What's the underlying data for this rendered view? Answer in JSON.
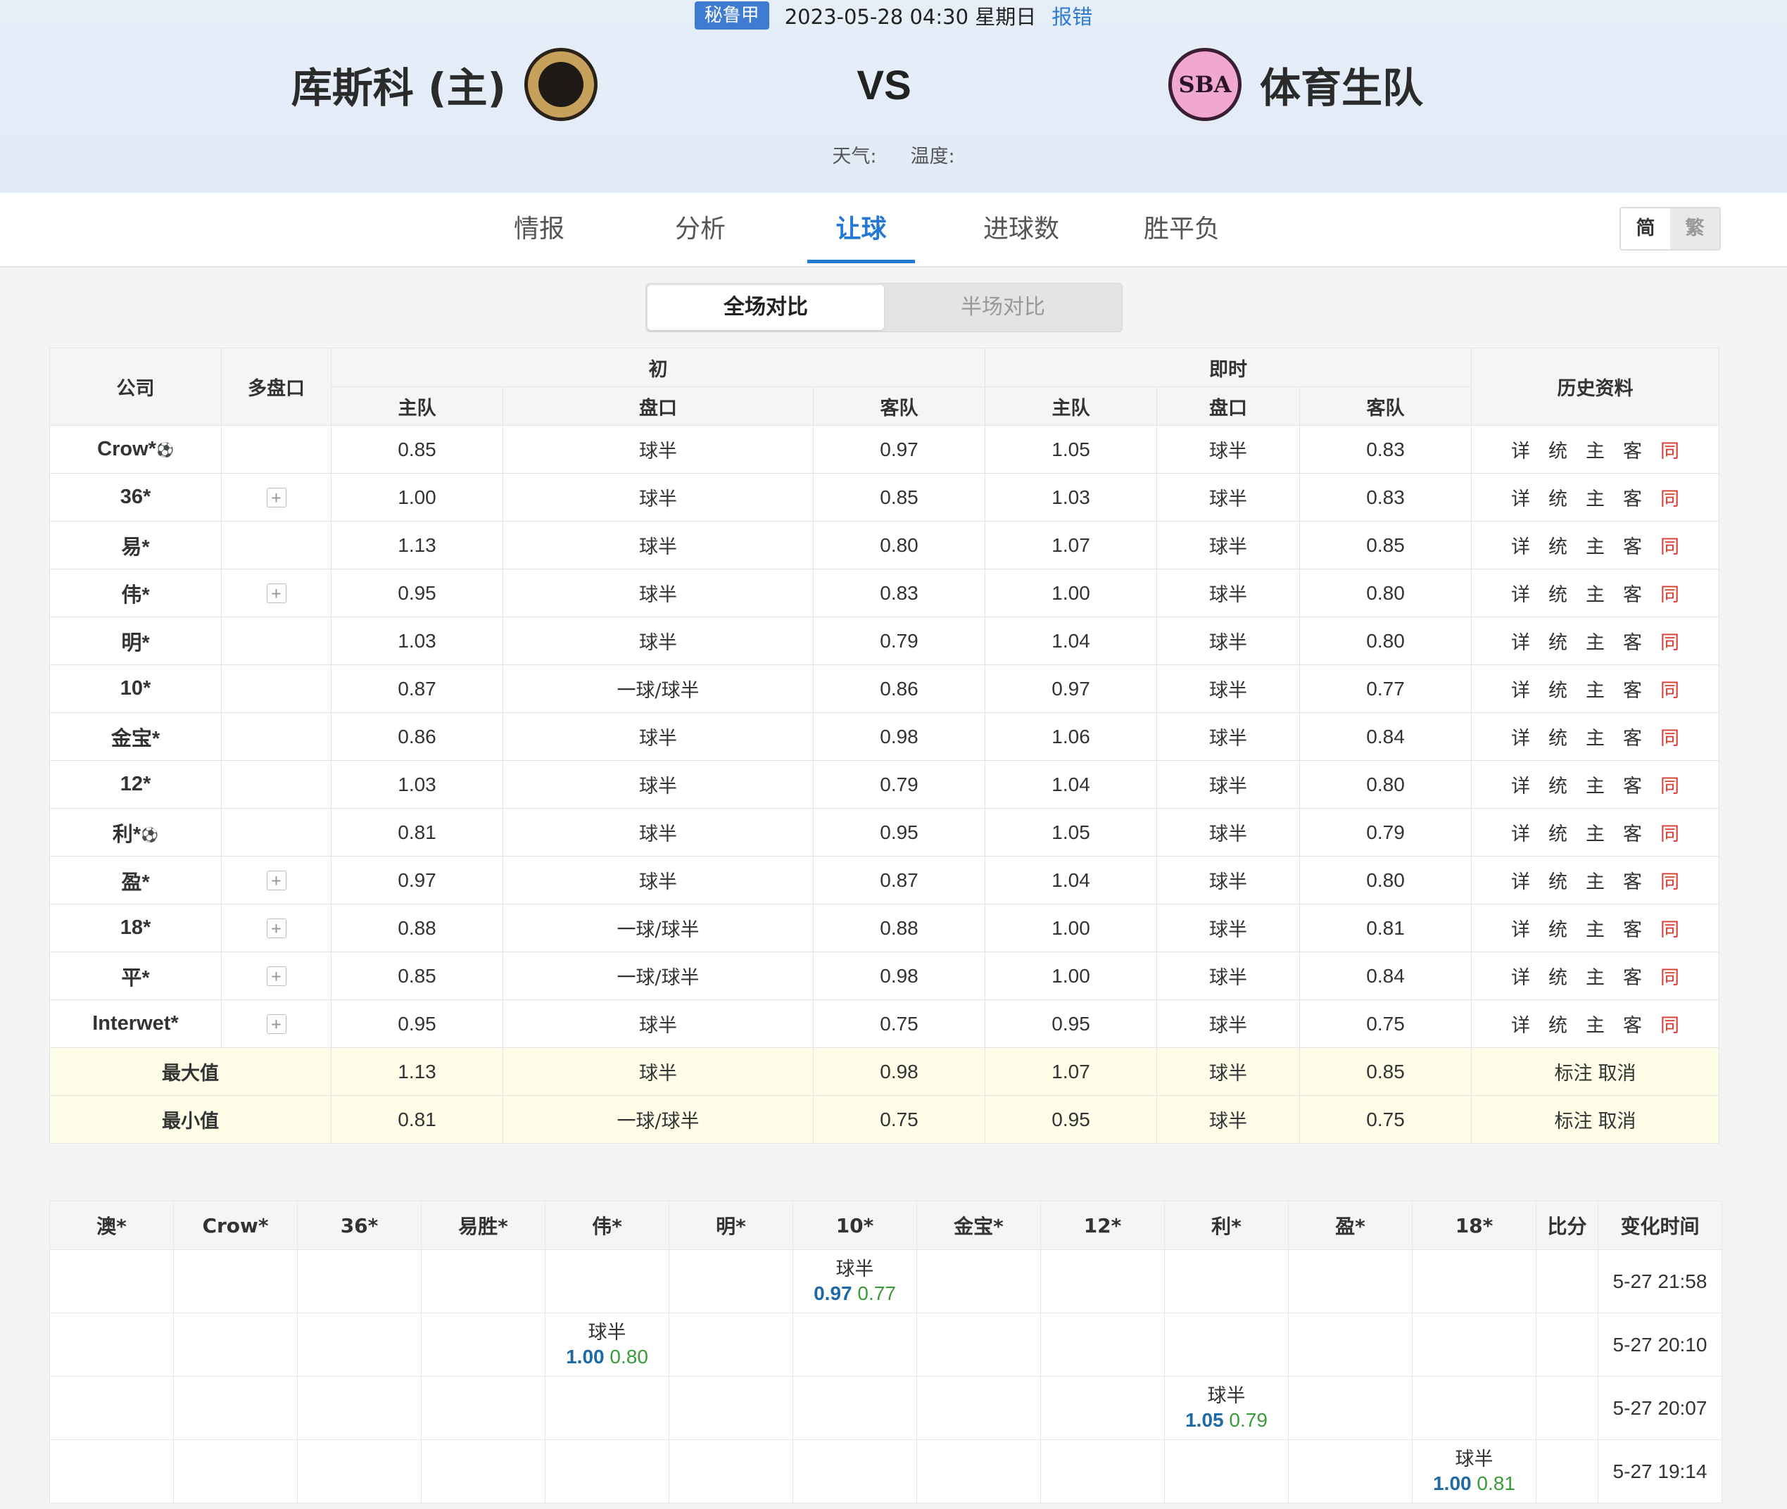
{
  "match": {
    "league": "秘鲁甲",
    "datetime": "2023-05-28 04:30 星期日",
    "report": "报错",
    "home_team": "库斯科 (主)",
    "away_team": "体育生队",
    "vs": "VS",
    "weather_label": "天气:",
    "temperature_label": "温度:",
    "away_logo_text": "SBA"
  },
  "tabs": [
    "情报",
    "分析",
    "让球",
    "进球数",
    "胜平负"
  ],
  "active_tab": "让球",
  "lang": {
    "simplified": "简",
    "traditional": "繁"
  },
  "segment": {
    "full": "全场对比",
    "half": "半场对比"
  },
  "odds_table": {
    "headers": {
      "company": "公司",
      "multi": "多盘口",
      "initial": "初",
      "live": "即时",
      "history": "历史资料",
      "home": "主队",
      "line": "盘口",
      "away": "客队"
    },
    "history_links": [
      "详",
      "统",
      "主",
      "客",
      "同"
    ],
    "rows": [
      {
        "company": "Crow*",
        "ball": true,
        "multi": false,
        "i_home": "0.85",
        "i_line": "球半",
        "i_away": "0.97",
        "l_home": "1.05",
        "l_line": "球半",
        "l_away": "0.83"
      },
      {
        "company": "36*",
        "ball": false,
        "multi": true,
        "i_home": "1.00",
        "i_line": "球半",
        "i_away": "0.85",
        "l_home": "1.03",
        "l_line": "球半",
        "l_away": "0.83"
      },
      {
        "company": "易*",
        "ball": false,
        "multi": false,
        "i_home": "1.13",
        "i_line": "球半",
        "i_away": "0.80",
        "l_home": "1.07",
        "l_line": "球半",
        "l_away": "0.85"
      },
      {
        "company": "伟*",
        "ball": false,
        "multi": true,
        "i_home": "0.95",
        "i_line": "球半",
        "i_away": "0.83",
        "l_home": "1.00",
        "l_line": "球半",
        "l_away": "0.80"
      },
      {
        "company": "明*",
        "ball": false,
        "multi": false,
        "i_home": "1.03",
        "i_line": "球半",
        "i_away": "0.79",
        "l_home": "1.04",
        "l_line": "球半",
        "l_away": "0.80"
      },
      {
        "company": "10*",
        "ball": false,
        "multi": false,
        "i_home": "0.87",
        "i_line": "一球/球半",
        "i_away": "0.86",
        "l_home": "0.97",
        "l_line": "球半",
        "l_away": "0.77"
      },
      {
        "company": "金宝*",
        "ball": false,
        "multi": false,
        "i_home": "0.86",
        "i_line": "球半",
        "i_away": "0.98",
        "l_home": "1.06",
        "l_line": "球半",
        "l_away": "0.84"
      },
      {
        "company": "12*",
        "ball": false,
        "multi": false,
        "i_home": "1.03",
        "i_line": "球半",
        "i_away": "0.79",
        "l_home": "1.04",
        "l_line": "球半",
        "l_away": "0.80"
      },
      {
        "company": "利*",
        "ball": true,
        "multi": false,
        "i_home": "0.81",
        "i_line": "球半",
        "i_away": "0.95",
        "l_home": "1.05",
        "l_line": "球半",
        "l_away": "0.79"
      },
      {
        "company": "盈*",
        "ball": false,
        "multi": true,
        "i_home": "0.97",
        "i_line": "球半",
        "i_away": "0.87",
        "l_home": "1.04",
        "l_line": "球半",
        "l_away": "0.80"
      },
      {
        "company": "18*",
        "ball": false,
        "multi": true,
        "i_home": "0.88",
        "i_line": "一球/球半",
        "i_away": "0.88",
        "l_home": "1.00",
        "l_line": "球半",
        "l_away": "0.81"
      },
      {
        "company": "平*",
        "ball": false,
        "multi": true,
        "i_home": "0.85",
        "i_line": "一球/球半",
        "i_away": "0.98",
        "l_home": "1.00",
        "l_line": "球半",
        "l_away": "0.84"
      },
      {
        "company": "Interwet*",
        "ball": false,
        "multi": true,
        "i_home": "0.95",
        "i_line": "球半",
        "i_away": "0.75",
        "l_home": "0.95",
        "l_line": "球半",
        "l_away": "0.75"
      }
    ],
    "summary": [
      {
        "label": "最大值",
        "i_home": "1.13",
        "i_line": "球半",
        "i_away": "0.98",
        "l_home": "1.07",
        "l_line": "球半",
        "l_away": "0.85",
        "mark": "标注",
        "cancel": "取消"
      },
      {
        "label": "最小值",
        "i_home": "0.81",
        "i_line": "一球/球半",
        "i_away": "0.75",
        "l_home": "0.95",
        "l_line": "球半",
        "l_away": "0.75",
        "mark": "标注",
        "cancel": "取消"
      }
    ]
  },
  "changes_table": {
    "headers": [
      "澳*",
      "Crow*",
      "36*",
      "易胜*",
      "伟*",
      "明*",
      "10*",
      "金宝*",
      "12*",
      "利*",
      "盈*",
      "18*",
      "比分",
      "变化时间"
    ],
    "rows": [
      {
        "col": 6,
        "line": "球半",
        "home": "0.97",
        "away": "0.77",
        "time": "5-27 21:58"
      },
      {
        "col": 4,
        "line": "球半",
        "home": "1.00",
        "away": "0.80",
        "time": "5-27 20:10"
      },
      {
        "col": 9,
        "line": "球半",
        "home": "1.05",
        "away": "0.79",
        "time": "5-27 20:07"
      },
      {
        "col": 11,
        "line": "球半",
        "home": "1.00",
        "away": "0.81",
        "time": "5-27 19:14"
      }
    ]
  }
}
